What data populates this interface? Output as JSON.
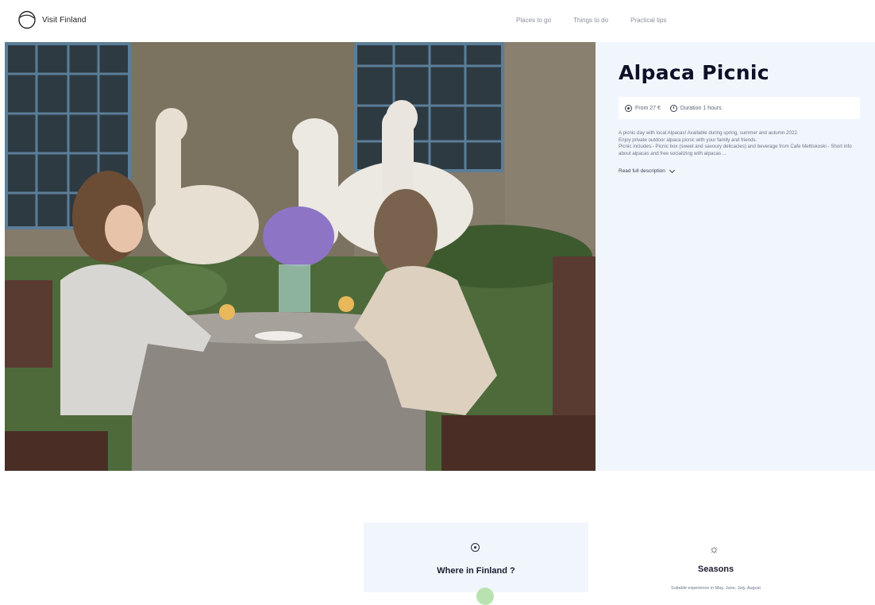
{
  "header": {
    "logo_text": "Visit Finland",
    "nav": [
      "Places to go",
      "Things to do",
      "Practical tips"
    ]
  },
  "activity": {
    "title": "Alpaca Picnic",
    "price": "From 27 €",
    "duration": "Duration 1 hours",
    "description": [
      "A picnic day with local Alpacas! Available during spring, summer and autumn 2022.",
      "Enjoy private outdoor alpaca picnic with your family and friends.",
      "Picnic includes:- Picnic box (sweet and savoury delicacies) and beverage from Cafe Mettiskoski - Short info about alpacas and free socializing with alpacas ..."
    ],
    "read_more": "Read full description"
  },
  "cards": {
    "where_title": "Where in Finland ?",
    "seasons_title": "Seasons",
    "seasons_text": "Suitable experience in May, June, July, August"
  },
  "colors": {
    "panel_bg": "#f1f6fc",
    "title": "#0d1027",
    "nav": "#8a8f9c"
  }
}
